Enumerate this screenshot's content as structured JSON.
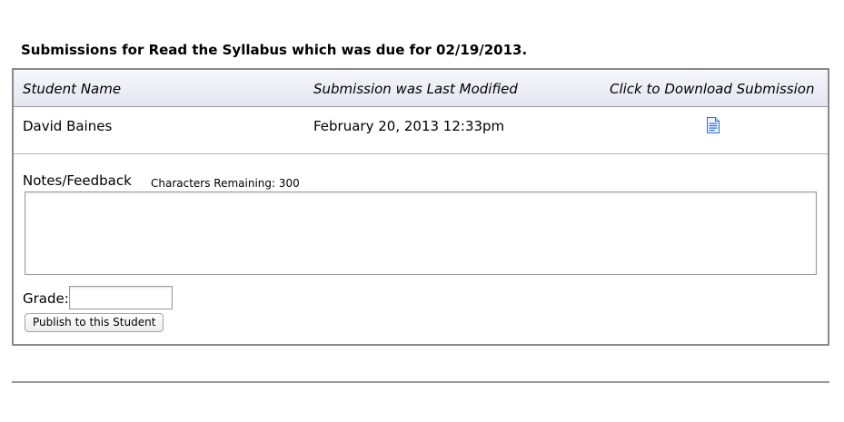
{
  "heading": "Submissions for Read the Syllabus which was due for 02/19/2013.",
  "table": {
    "columns": {
      "student_name": "Student Name",
      "last_modified": "Submission was Last Modified",
      "download": "Click to Download Submission"
    },
    "rows": [
      {
        "student_name": "David Baines",
        "last_modified": "February 20, 2013 12:33pm",
        "download_icon": "document-icon"
      }
    ]
  },
  "feedback": {
    "label": "Notes/Feedback",
    "chars_remaining": "Characters Remaining: 300",
    "value": ""
  },
  "grade": {
    "label": "Grade:",
    "value": ""
  },
  "publish_button": "Publish to this Student",
  "colors": {
    "header_bg": "#e6e6f1",
    "border": "#8a8a8a",
    "icon_blue": "#2f6fd6"
  }
}
